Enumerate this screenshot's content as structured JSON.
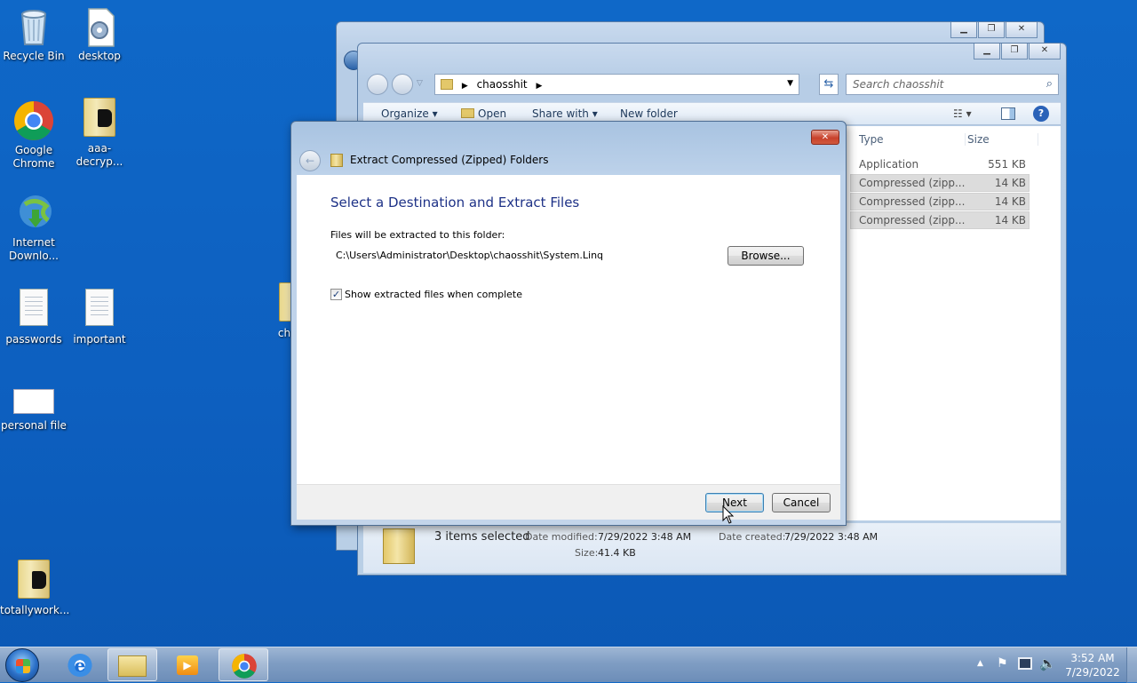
{
  "desktop": {
    "icons": [
      {
        "label": "Recycle Bin"
      },
      {
        "label": "desktop"
      },
      {
        "label": "Google Chrome"
      },
      {
        "label": "aaa-decryp..."
      },
      {
        "label": "Internet Downlo..."
      },
      {
        "label": "passwords"
      },
      {
        "label": "important"
      },
      {
        "label": "personal file"
      },
      {
        "label": "totallywork..."
      },
      {
        "label": "ch"
      }
    ]
  },
  "explorer": {
    "breadcrumb": "chaosshit",
    "search_placeholder": "Search chaosshit",
    "toolbar": {
      "organize": "Organize",
      "open": "Open",
      "share_with": "Share with",
      "new_folder": "New folder"
    },
    "columns": {
      "type": "Type",
      "size": "Size"
    },
    "rows": [
      {
        "type": "Application",
        "size": "551 KB"
      },
      {
        "type": "Compressed (zipp...",
        "size": "14 KB"
      },
      {
        "type": "Compressed (zipp...",
        "size": "14 KB"
      },
      {
        "type": "Compressed (zipp...",
        "size": "14 KB"
      }
    ],
    "details": {
      "selection": "3 items selected",
      "date_modified_label": "Date modified:",
      "date_modified": "7/29/2022 3:48 AM",
      "date_created_label": "Date created:",
      "date_created": "7/29/2022 3:48 AM",
      "size_label": "Size:",
      "size": "41.4 KB"
    }
  },
  "dialog": {
    "title": "Extract Compressed (Zipped) Folders",
    "heading": "Select a Destination and Extract Files",
    "folder_label": "Files will be extracted to this folder:",
    "path": "C:\\Users\\Administrator\\Desktop\\chaosshit\\System.Linq",
    "browse": "Browse...",
    "checkbox_label": "Show extracted files when complete",
    "checkbox_checked": true,
    "next": "Next",
    "cancel": "Cancel"
  },
  "taskbar": {
    "time": "3:52 AM",
    "date": "7/29/2022"
  },
  "colors": {
    "desktop": "#0f68c8",
    "dialog_heading": "#1e3287"
  }
}
